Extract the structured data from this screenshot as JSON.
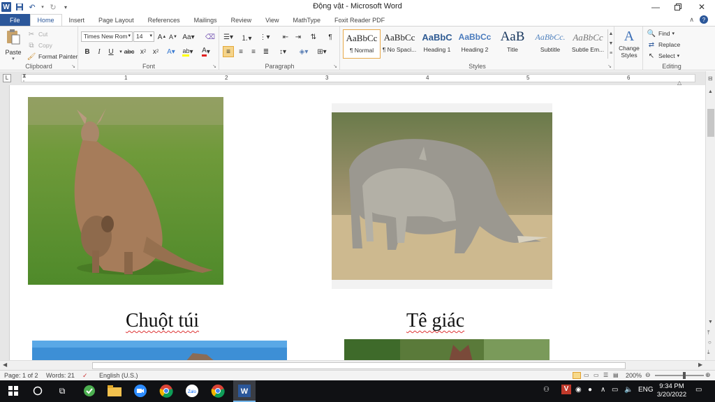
{
  "window": {
    "title": "Động vật  -  Microsoft Word"
  },
  "tabs": [
    "File",
    "Home",
    "Insert",
    "Page Layout",
    "References",
    "Mailings",
    "Review",
    "View",
    "MathType",
    "Foxit Reader PDF"
  ],
  "clipboard": {
    "paste": "Paste",
    "cut": "Cut",
    "copy": "Copy",
    "format_painter": "Format Painter",
    "label": "Clipboard"
  },
  "font": {
    "family": "Times New Rom",
    "size": "14",
    "label": "Font"
  },
  "paragraph": {
    "label": "Paragraph"
  },
  "styles": {
    "items": [
      {
        "sample": "AaBbCc",
        "name": "¶ Normal"
      },
      {
        "sample": "AaBbCc",
        "name": "¶ No Spaci..."
      },
      {
        "sample": "AaBbC",
        "name": "Heading 1"
      },
      {
        "sample": "AaBbCc",
        "name": "Heading 2"
      },
      {
        "sample": "AaB",
        "name": "Title"
      },
      {
        "sample": "AaBbCc.",
        "name": "Subtitle"
      },
      {
        "sample": "AaBbCc",
        "name": "Subtle Em..."
      }
    ],
    "change_styles": "Change Styles",
    "label": "Styles"
  },
  "editing": {
    "find": "Find",
    "replace": "Replace",
    "select": "Select",
    "label": "Editing"
  },
  "ruler_numbers": [
    "1",
    "1",
    "2",
    "3",
    "4",
    "5",
    "6"
  ],
  "document": {
    "captions": [
      "Chuột túi",
      "Tê giác"
    ]
  },
  "statusbar": {
    "page": "Page: 1 of 2",
    "words": "Words: 21",
    "language": "English (U.S.)",
    "zoom": "200%"
  },
  "taskbar": {
    "language": "ENG",
    "time": "9:34 PM",
    "date": "3/20/2022",
    "apps": [
      "start",
      "search",
      "task-view",
      "app-green",
      "file-explorer",
      "zoom",
      "chrome",
      "zalo",
      "chrome",
      "word"
    ]
  }
}
